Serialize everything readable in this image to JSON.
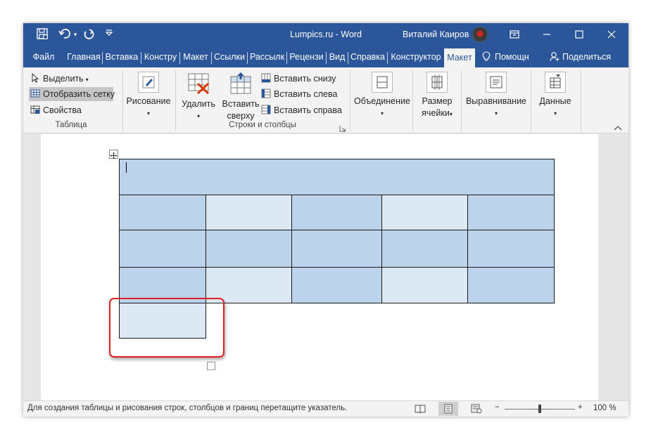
{
  "window": {
    "title": "Lumpics.ru  -  Word",
    "user_name": "Виталий Каиров",
    "quick_access": {
      "save_icon": "save-icon",
      "undo_icon": "undo-icon",
      "redo_icon": "redo-icon",
      "customize_icon": "customize-qat-icon"
    },
    "controls": {
      "ribbon_display": "ribbon-display-icon",
      "minimize": "minimize-icon",
      "maximize": "maximize-icon",
      "close": "close-icon"
    }
  },
  "tabs": [
    {
      "label": "Файл"
    },
    {
      "label": "Главная"
    },
    {
      "label": "Вставка"
    },
    {
      "label": "Констру"
    },
    {
      "label": "Макет"
    },
    {
      "label": "Ссылки"
    },
    {
      "label": "Рассылк"
    },
    {
      "label": "Рецензи"
    },
    {
      "label": "Вид"
    },
    {
      "label": "Справка"
    },
    {
      "label": "Конструктор"
    },
    {
      "label": "Макет",
      "active": true
    },
    {
      "label": "Помощн"
    },
    {
      "label": "Поделиться"
    }
  ],
  "ribbon": {
    "table_group": {
      "label": "Таблица",
      "select": "Выделить",
      "show_grid": "Отобразить сетку",
      "properties": "Свойства"
    },
    "draw": {
      "label": "Рисование"
    },
    "rows_cols_group": {
      "label": "Строки и столбцы",
      "delete": "Удалить",
      "insert_above_l1": "Вставить",
      "insert_above_l2": "сверху",
      "insert_below": "Вставить снизу",
      "insert_left": "Вставить слева",
      "insert_right": "Вставить справа"
    },
    "merge": {
      "label": "Объединение"
    },
    "cell_size": {
      "label_l1": "Размер",
      "label_l2": "ячейки"
    },
    "alignment": {
      "label": "Выравнивание"
    },
    "data": {
      "label": "Данные"
    }
  },
  "status": {
    "text": "Для создания таблицы и рисования строк, столбцов и границ перетащите указатель.",
    "zoom_minus": "−",
    "zoom_plus": "+",
    "zoom_level": "100 %",
    "zoom_fraction": 0.5
  },
  "colors": {
    "title_blue": "#2b579a",
    "cell_dark": "#bcd3ec",
    "cell_light": "#dde8f5",
    "highlight_red": "#e02020"
  }
}
